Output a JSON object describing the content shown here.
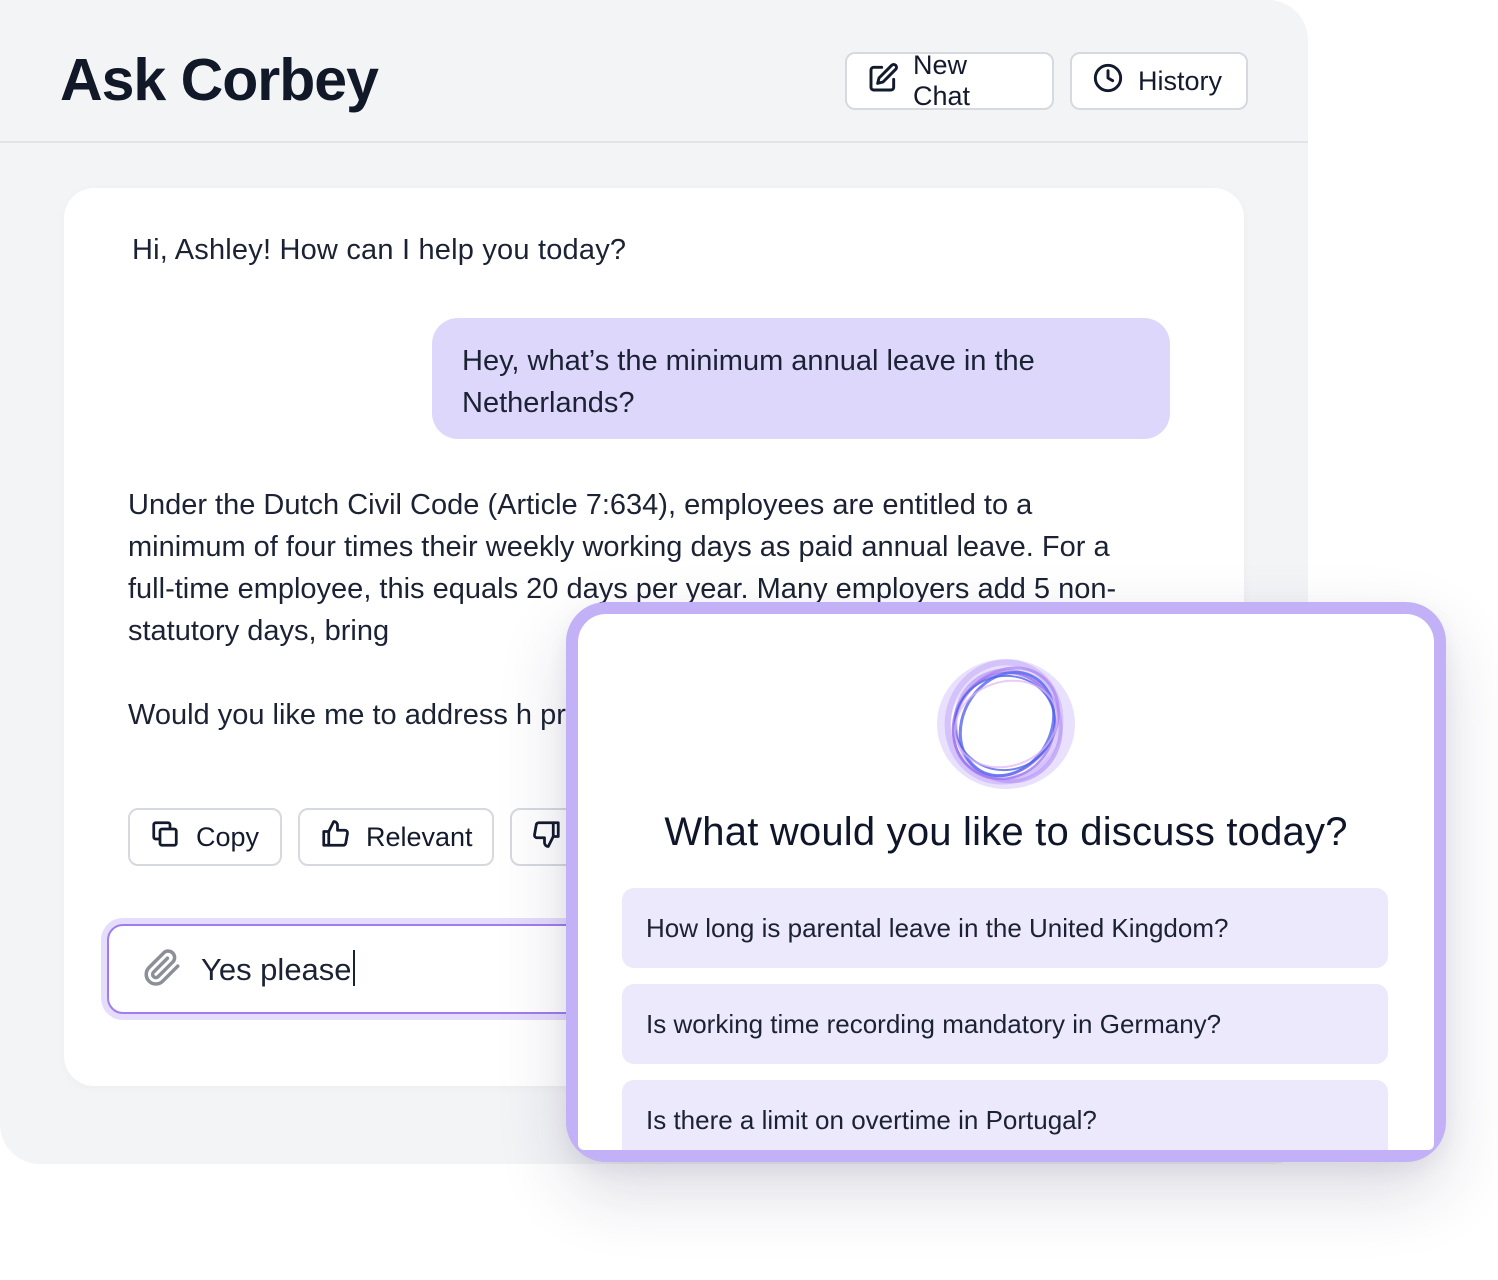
{
  "header": {
    "title": "Ask Corbey",
    "new_chat_label": "New Chat",
    "history_label": "History"
  },
  "chat": {
    "greeting": "Hi, Ashley! How can I help you today?",
    "user_message": "Hey, what’s the minimum annual leave in the Netherlands?",
    "answer_paragraph_1": "Under the Dutch Civil Code (Article 7:634), employees are entitled to a minimum of four times their weekly working days as paid annual leave. For a full-time employee, this equals 20 days per year. Many employers add 5 non-statutory days, bring",
    "answer_paragraph_2": "Would you like me to address h pregnancy leave, or other peric",
    "actions": {
      "copy_label": "Copy",
      "relevant_label": "Relevant"
    }
  },
  "composer": {
    "value": "Yes please"
  },
  "popup": {
    "title": "What would you like to discuss today?",
    "suggestions": [
      "How long is parental leave in the United Kingdom?",
      "Is working time recording mandatory in Germany?",
      "Is there a limit on overtime in Portugal?"
    ]
  },
  "colors": {
    "user_bubble": "#ddd7fc",
    "accent": "#9f7df0",
    "popup_frame": "#c2b1f6",
    "suggestion_bg": "#ede9fd"
  },
  "icons": [
    "edit-icon",
    "clock-icon",
    "copy-icon",
    "thumbs-up-icon",
    "thumbs-down-icon",
    "paperclip-icon",
    "corbey-logo"
  ]
}
